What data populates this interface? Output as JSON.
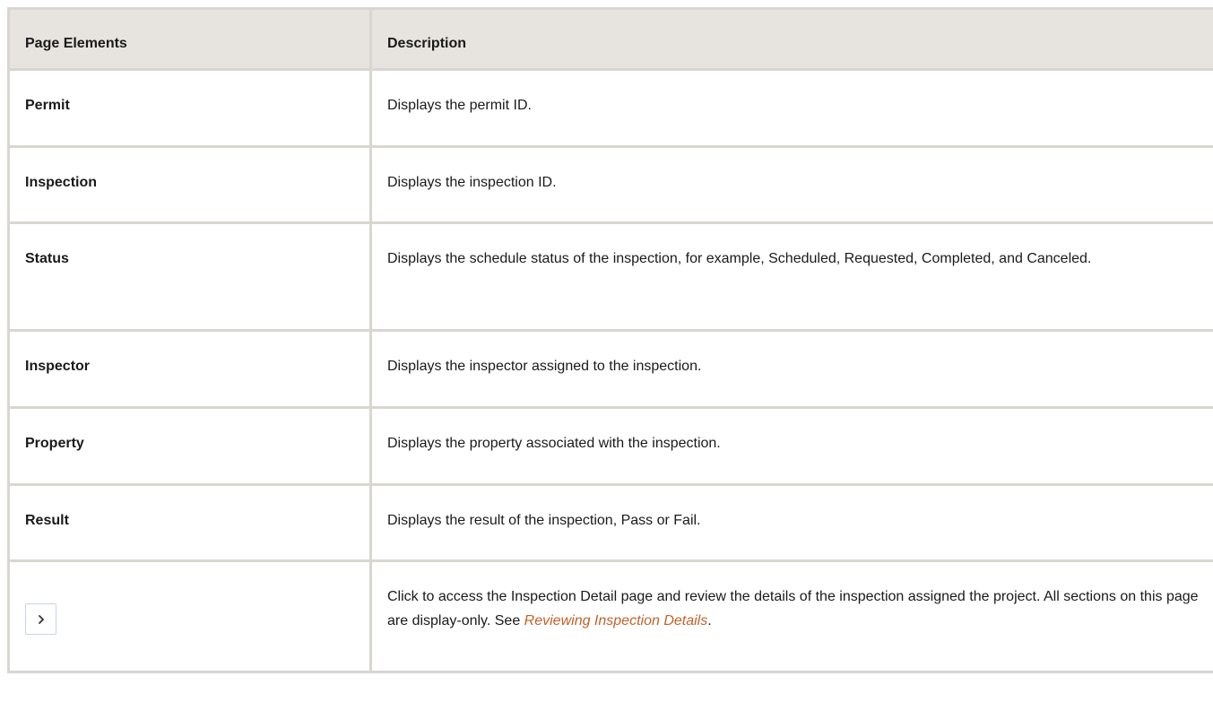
{
  "table": {
    "headers": {
      "element": "Page Elements",
      "description": "Description"
    },
    "rows": [
      {
        "element": "Permit",
        "description": "Displays the permit ID."
      },
      {
        "element": "Inspection",
        "description": "Displays the inspection ID."
      },
      {
        "element": "Status",
        "description": "Displays the schedule status of the inspection, for example, Scheduled, Requested, Completed,  and Canceled."
      },
      {
        "element": "Inspector",
        "description": "Displays the inspector assigned to the inspection."
      },
      {
        "element": "Property",
        "description": "Displays the property associated with the inspection."
      },
      {
        "element": "Result",
        "description": "Displays the result of the inspection, Pass or Fail."
      }
    ],
    "nav_row": {
      "icon": "chevron-right-icon",
      "description_before": "Click to access the Inspection Detail page and review the details of the inspection assigned the project. All sections on this page are display-only. See ",
      "link_text": "Reviewing Inspection Details",
      "description_after": "."
    }
  },
  "colors": {
    "header_bg": "#e7e4df",
    "border": "#d9d6d1",
    "link": "#c0622b"
  }
}
